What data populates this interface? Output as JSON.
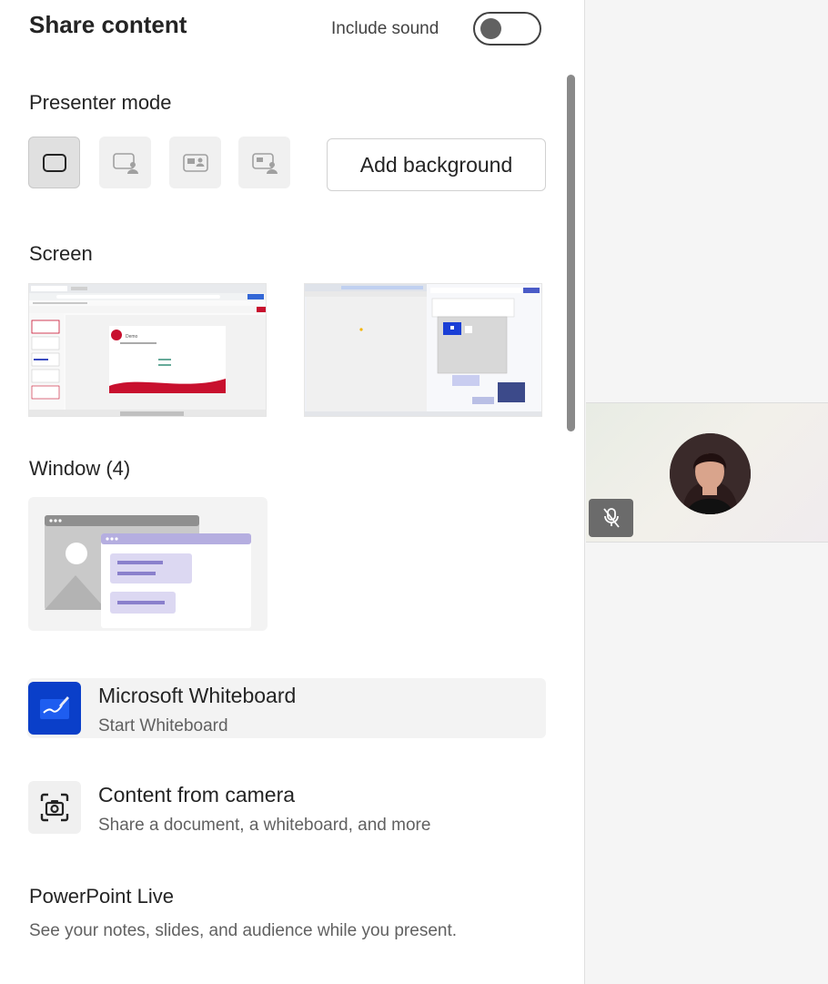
{
  "header": {
    "title": "Share content",
    "include_sound_label": "Include sound",
    "include_sound_on": false
  },
  "presenter_mode": {
    "label": "Presenter mode",
    "modes": [
      "content-only",
      "standout",
      "side-by-side",
      "reporter"
    ],
    "selected": "content-only",
    "add_background_label": "Add background"
  },
  "screen": {
    "label": "Screen",
    "thumb1_slide_title": "Demo"
  },
  "window": {
    "label": "Window (4)"
  },
  "options": {
    "whiteboard": {
      "title": "Microsoft Whiteboard",
      "subtitle": "Start Whiteboard",
      "icon": "whiteboard-icon"
    },
    "camera": {
      "title": "Content from camera",
      "subtitle": "Share a document, a whiteboard, and more",
      "icon": "camera-icon"
    }
  },
  "powerpoint": {
    "title": "PowerPoint Live",
    "subtitle": "See your notes, slides, and audience while you present."
  },
  "participant": {
    "muted": true,
    "icon": "mic-off-icon"
  },
  "colors": {
    "whiteboard_blue": "#0a3fc9",
    "slide_red": "#c8102e",
    "window_purple": "#d9d4ef"
  }
}
